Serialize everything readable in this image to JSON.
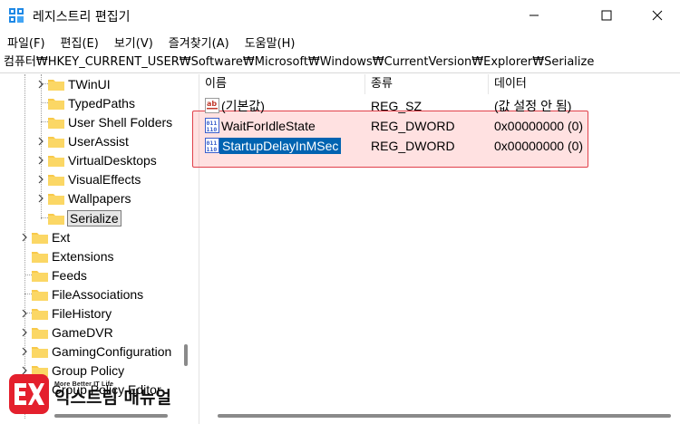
{
  "window": {
    "title": "레지스트리 편집기"
  },
  "menu": [
    {
      "label": "파일(F)"
    },
    {
      "label": "편집(E)"
    },
    {
      "label": "보기(V)"
    },
    {
      "label": "즐겨찾기(A)"
    },
    {
      "label": "도움말(H)"
    }
  ],
  "address": {
    "path": "컴퓨터₩HKEY_CURRENT_USER₩Software₩Microsoft₩Windows₩CurrentVersion₩Explorer₩Serialize"
  },
  "tree": {
    "items": [
      {
        "label": "TWinUI",
        "expandable": true
      },
      {
        "label": "TypedPaths",
        "expandable": false
      },
      {
        "label": "User Shell Folders",
        "expandable": false
      },
      {
        "label": "UserAssist",
        "expandable": true
      },
      {
        "label": "VirtualDesktops",
        "expandable": true
      },
      {
        "label": "VisualEffects",
        "expandable": true
      },
      {
        "label": "Wallpapers",
        "expandable": true
      },
      {
        "label": "Serialize",
        "expandable": false,
        "selected": true
      },
      {
        "label": "Ext",
        "expandable": true
      },
      {
        "label": "Extensions",
        "expandable": false
      },
      {
        "label": "Feeds",
        "expandable": false
      },
      {
        "label": "FileAssociations",
        "expandable": false
      },
      {
        "label": "FileHistory",
        "expandable": true
      },
      {
        "label": "GameDVR",
        "expandable": true
      },
      {
        "label": "GamingConfiguration",
        "expandable": true
      },
      {
        "label": "Group Policy",
        "expandable": true
      },
      {
        "label": "Group Policy Editor",
        "expandable": true
      }
    ]
  },
  "values": {
    "columns": [
      {
        "label": "이름"
      },
      {
        "label": "종류"
      },
      {
        "label": "데이터"
      }
    ],
    "rows": [
      {
        "name": "(기본값)",
        "type": "REG_SZ",
        "data": "(값 설정 안 됨)",
        "icon": "string-value-icon"
      },
      {
        "name": "WaitForIdleState",
        "type": "REG_DWORD",
        "data": "0x00000000 (0)",
        "icon": "dword-value-icon"
      },
      {
        "name": "StartupDelayInMSec",
        "type": "REG_DWORD",
        "data": "0x00000000 (0)",
        "icon": "dword-value-icon",
        "selected": true
      }
    ]
  },
  "watermark": {
    "tagline": "More Better IT Life",
    "brand": "익스트림 매뉴얼",
    "logo_text": "EX"
  },
  "colors": {
    "selection": "#0063b1",
    "highlight_border": "#e0404a",
    "folder": "#f8c94a",
    "brand_red": "#e4202d"
  }
}
